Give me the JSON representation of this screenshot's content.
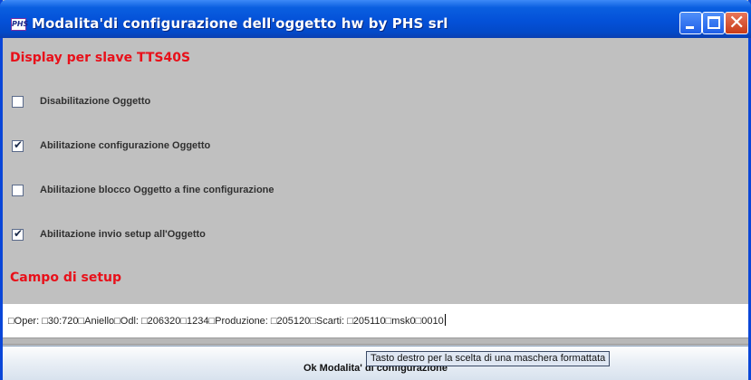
{
  "window": {
    "app_icon_text": "PHS",
    "title": "Modalita'di configurazione dell'oggetto hw by PHS srl"
  },
  "sections": {
    "display_heading": "Display per slave TTS40S",
    "setup_heading": "Campo di setup"
  },
  "options": [
    {
      "label": "Disabilitazione Oggetto",
      "checked": false
    },
    {
      "label": "Abilitazione configurazione Oggetto",
      "checked": true
    },
    {
      "label": "Abilitazione blocco Oggetto a fine configurazione",
      "checked": false
    },
    {
      "label": "Abilitazione invio setup all'Oggetto",
      "checked": true
    }
  ],
  "setup_field": {
    "value": "□Oper: □30:720□Aniello□Odl: □206320□1234□Produzione: □205120□Scarti: □205110□msk0□0010"
  },
  "ok_button": {
    "label": "Ok Modalita' di configurazione"
  },
  "tooltip": {
    "text": "Tasto destro per la scelta di una maschera formattata"
  },
  "colors": {
    "heading": "#e8101a",
    "titlebar": "#0451d8",
    "panel": "#c0c0c0"
  }
}
